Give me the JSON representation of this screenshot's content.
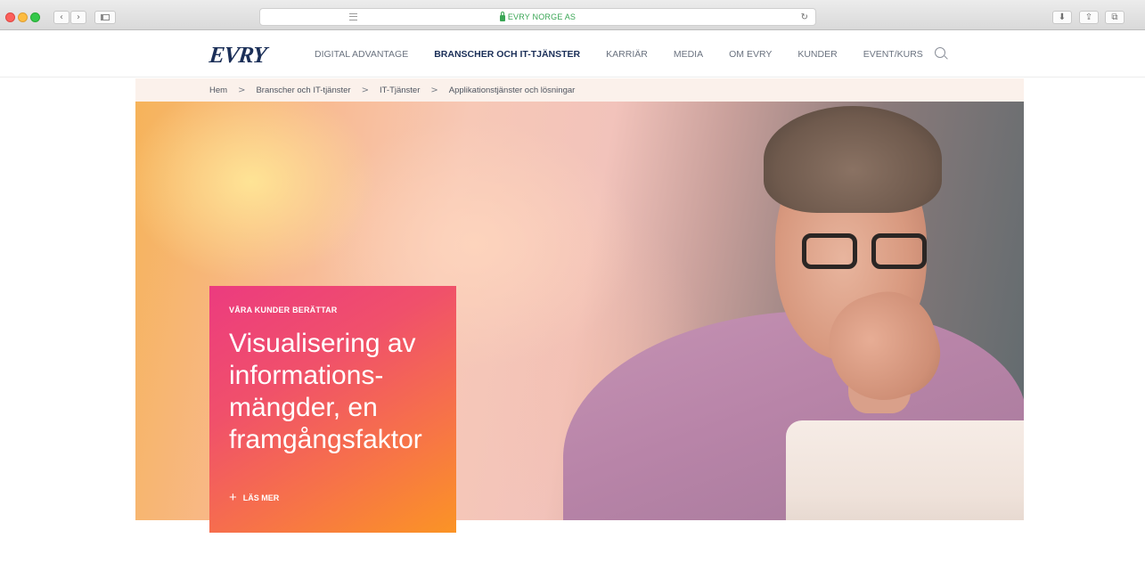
{
  "browser": {
    "address": "EVRY NORGE AS",
    "icons": [
      "back-icon",
      "forward-icon",
      "sidebar-icon",
      "lock-icon",
      "reader-icon",
      "reload-icon",
      "download-icon",
      "share-icon",
      "tabs-icon"
    ],
    "back_glyph": "‹",
    "forward_glyph": "›",
    "reload_glyph": "↻",
    "download_glyph": "⬇",
    "share_glyph": "⇪",
    "tabs_glyph": "⧉"
  },
  "header": {
    "logo": "EVRY",
    "nav": [
      {
        "label": "DIGITAL ADVANTAGE",
        "active": false
      },
      {
        "label": "BRANSCHER OCH IT-TJÄNSTER",
        "active": true
      },
      {
        "label": "KARRIÄR",
        "active": false
      },
      {
        "label": "MEDIA",
        "active": false
      },
      {
        "label": "OM EVRY",
        "active": false
      },
      {
        "label": "KUNDER",
        "active": false
      },
      {
        "label": "EVENT/KURS",
        "active": false
      }
    ]
  },
  "breadcrumb": {
    "separator": ">",
    "items": [
      "Hem",
      "Branscher och IT-tjänster",
      "IT-Tjänster",
      "Applikationstjänster och lösningar"
    ]
  },
  "story": {
    "kicker": "VÅRA KUNDER BERÄTTAR",
    "title": "Visualisering av informations-mängder, en framgångsfaktor",
    "link_icon": "+",
    "link_label": "LÄS MER"
  },
  "colors": {
    "brand": "#1b2f58",
    "card_gradient_start": "#ec3b7f",
    "card_gradient_end": "#fb9425",
    "secure": "#3aa655"
  }
}
